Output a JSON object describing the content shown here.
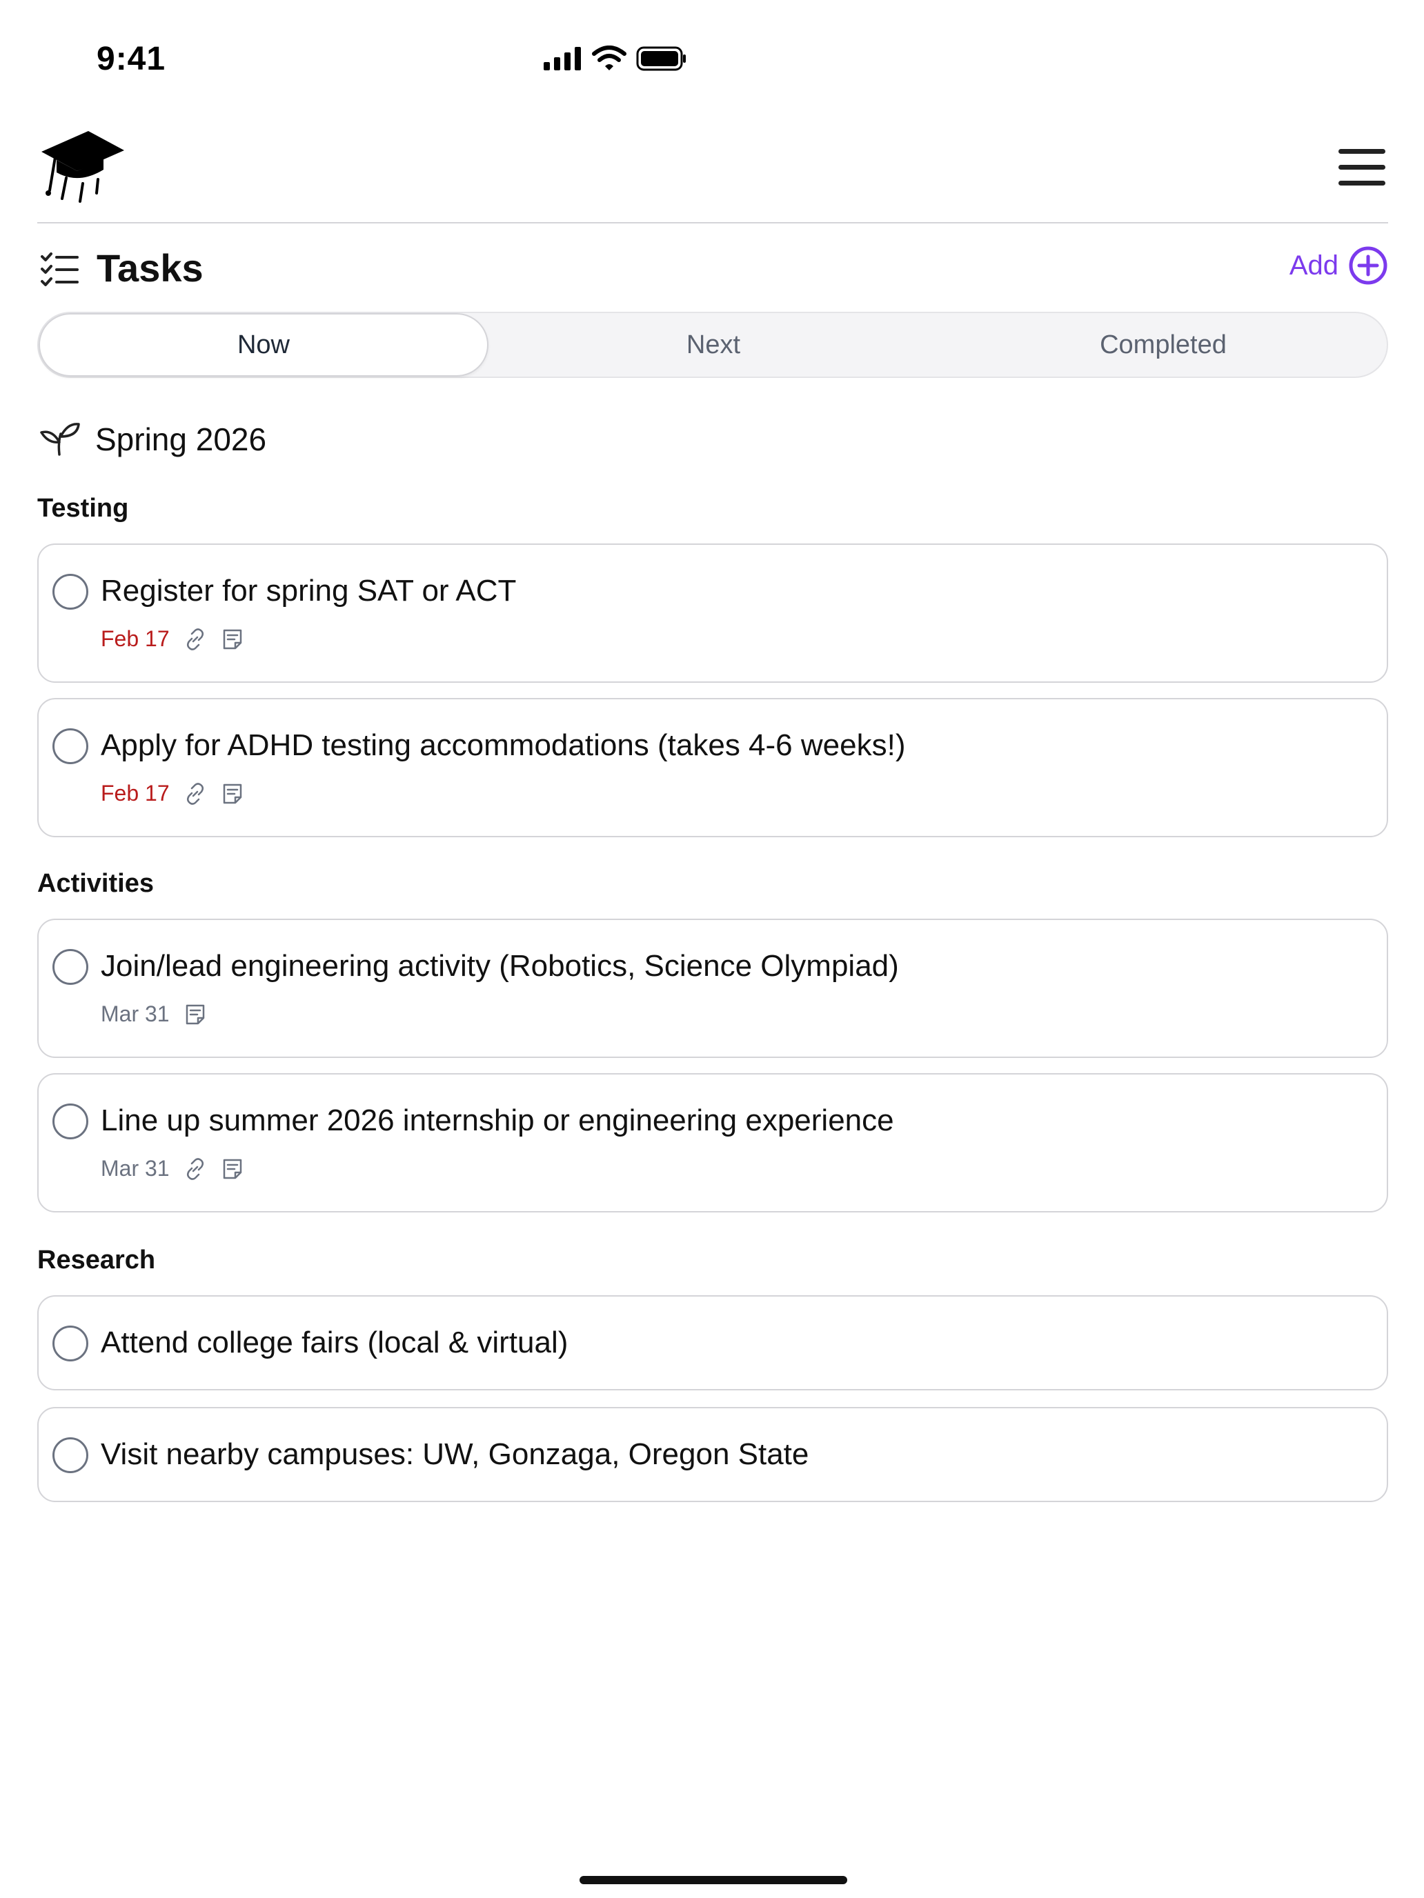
{
  "status_bar": {
    "time": "9:41"
  },
  "header": {
    "logo_icon": "graduation-cap-icon",
    "menu_icon": "hamburger-menu-icon"
  },
  "page": {
    "title": "Tasks",
    "title_icon": "checklist-icon",
    "add_label": "Add",
    "accent_color": "#7c3aed"
  },
  "tabs": [
    {
      "label": "Now",
      "active": true
    },
    {
      "label": "Next",
      "active": false
    },
    {
      "label": "Completed",
      "active": false
    }
  ],
  "season": {
    "title": "Spring 2026",
    "icon": "sprout-icon"
  },
  "sections": [
    {
      "title": "Testing",
      "tasks": [
        {
          "title": "Register for spring SAT or ACT",
          "due": "Feb 17",
          "overdue": true,
          "has_link": true,
          "has_note": true
        },
        {
          "title": "Apply for ADHD testing accommodations (takes 4-6 weeks!)",
          "due": "Feb 17",
          "overdue": true,
          "has_link": true,
          "has_note": true
        }
      ]
    },
    {
      "title": "Activities",
      "tasks": [
        {
          "title": "Join/lead engineering activity (Robotics, Science Olympiad)",
          "due": "Mar 31",
          "overdue": false,
          "has_link": false,
          "has_note": true
        },
        {
          "title": "Line up summer 2026 internship or engineering experience",
          "due": "Mar 31",
          "overdue": false,
          "has_link": true,
          "has_note": true
        }
      ]
    },
    {
      "title": "Research",
      "tasks": [
        {
          "title": "Attend college fairs (local & virtual)",
          "due": "",
          "overdue": false,
          "has_link": false,
          "has_note": false
        },
        {
          "title": "Visit nearby campuses: UW, Gonzaga, Oregon State",
          "due": "",
          "overdue": false,
          "has_link": false,
          "has_note": false
        }
      ]
    }
  ],
  "colors": {
    "overdue": "#b91c1c",
    "muted": "#6b7280"
  }
}
